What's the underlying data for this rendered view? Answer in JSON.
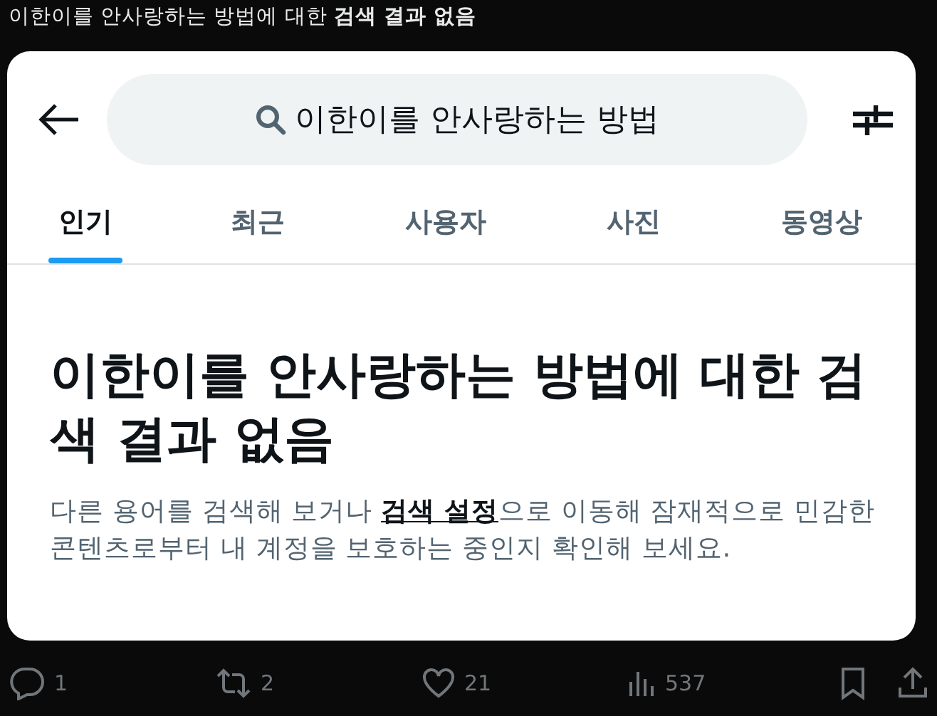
{
  "post_text": "이한이를 안사랑하는 방법에 대한 **검색 결과 없음**",
  "screenshot": {
    "search": {
      "value": "이한이를 안사랑하는 방법"
    },
    "tabs": [
      {
        "label": "인기",
        "selected": true
      },
      {
        "label": "최근",
        "selected": false
      },
      {
        "label": "사용자",
        "selected": false
      },
      {
        "label": "사진",
        "selected": false
      },
      {
        "label": "동영상",
        "selected": false
      }
    ],
    "empty_title": "이한이를 안사랑하는 방법에 대한 검색 결과 없음",
    "empty_text_before": "다른 용어를 검색해 보거나",
    "empty_text_link": "검색 설정",
    "empty_text_after": "으로 이동해 잠재적으로 민감한 콘텐츠로부터 내 계정을 보호하는 중인지 확인해 보세요."
  },
  "actions": [
    {
      "kind": "reply",
      "count": "1"
    },
    {
      "kind": "repost",
      "count": "2"
    },
    {
      "kind": "like",
      "count": "21"
    },
    {
      "kind": "views",
      "count": "537"
    },
    {
      "kind": "bookmark"
    },
    {
      "kind": "share"
    }
  ]
}
